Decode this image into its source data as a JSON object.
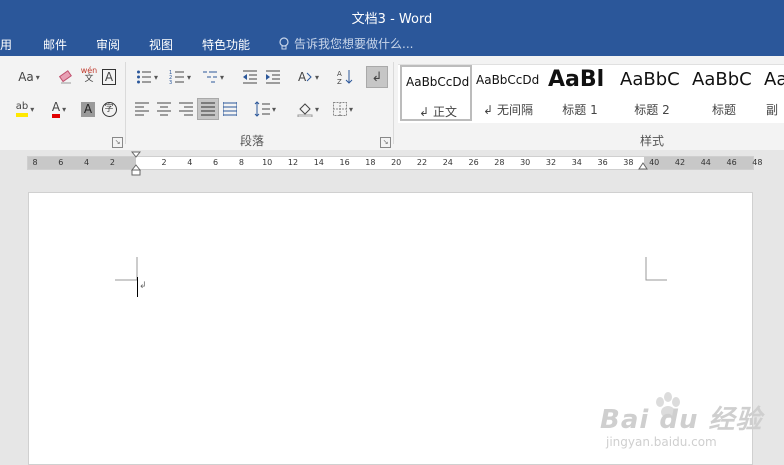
{
  "window": {
    "title": "文档3 - Word"
  },
  "menu": {
    "tabs": [
      "用",
      "邮件",
      "审阅",
      "视图",
      "特色功能"
    ],
    "tell_me": "告诉我您想要做什么..."
  },
  "ribbon": {
    "font_group": {
      "change_case": "Aa",
      "phonetic": "wén",
      "char_border": "A",
      "char_shading": "A",
      "enclose": "字",
      "highlight": "ab",
      "font_color": "A"
    },
    "paragraph_group": {
      "label": "段落"
    },
    "styles_group": {
      "label": "样式",
      "items": [
        {
          "sample": "AaBbCcDd",
          "name": "正文",
          "mark": "↲"
        },
        {
          "sample": "AaBbCcDd",
          "name": "无间隔",
          "mark": "↲"
        },
        {
          "sample": "AaBl",
          "name": "标题 1",
          "mark": ""
        },
        {
          "sample": "AaBbC",
          "name": "标题 2",
          "mark": ""
        },
        {
          "sample": "AaBbC",
          "name": "标题",
          "mark": ""
        },
        {
          "sample": "Aa",
          "name": "副",
          "mark": ""
        }
      ]
    }
  },
  "ruler": {
    "ticks": [
      "8",
      "6",
      "4",
      "2",
      "",
      "2",
      "4",
      "6",
      "8",
      "10",
      "12",
      "14",
      "16",
      "18",
      "20",
      "22",
      "24",
      "26",
      "28",
      "30",
      "32",
      "34",
      "36",
      "38",
      "40",
      "42",
      "44",
      "46",
      "48"
    ]
  },
  "watermark": {
    "brand": "Bai du 经验",
    "url": "jingyan.baidu.com"
  }
}
